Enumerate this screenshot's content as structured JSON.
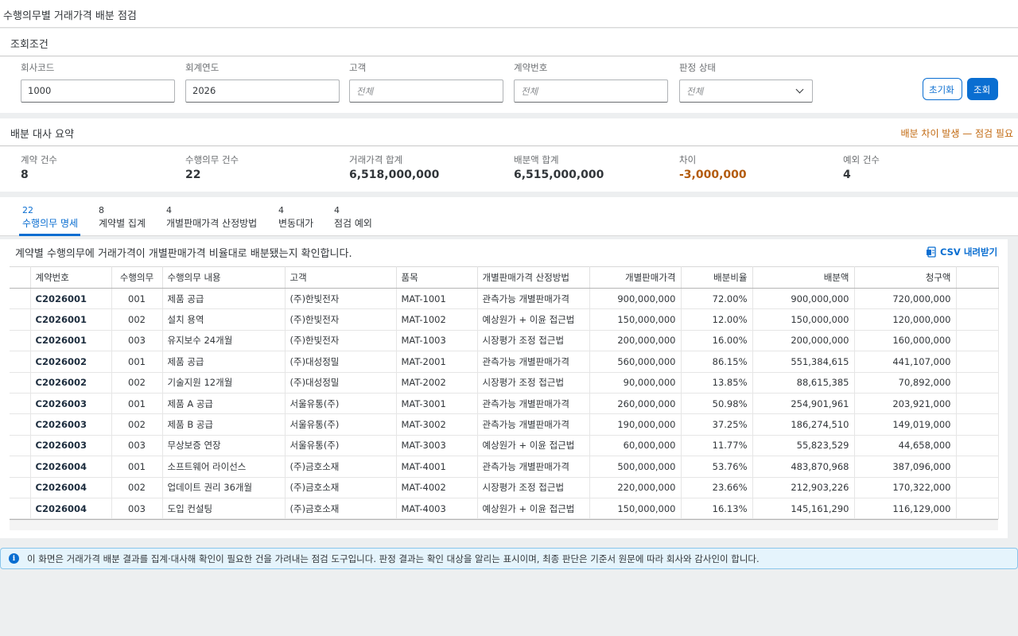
{
  "page": {
    "title": "수행의무별 거래가격 배분 점검"
  },
  "filters": {
    "section_title": "조회조건",
    "company_code": {
      "label": "회사코드",
      "value": "1000"
    },
    "fiscal_year": {
      "label": "회계연도",
      "value": "2026"
    },
    "customer": {
      "label": "고객",
      "placeholder": "전체"
    },
    "contract_no": {
      "label": "계약번호",
      "placeholder": "전체"
    },
    "status": {
      "label": "판정 상태",
      "value": "전체"
    },
    "reset_label": "초기화",
    "search_label": "조회"
  },
  "summary": {
    "section_title": "배분 대사 요약",
    "warning": "배분 차이 발생 — 점검 필요",
    "kpis": [
      {
        "label": "계약 건수",
        "value": "8"
      },
      {
        "label": "수행의무 건수",
        "value": "22"
      },
      {
        "label": "거래가격 합계",
        "value": "6,518,000,000"
      },
      {
        "label": "배분액 합계",
        "value": "6,515,000,000"
      },
      {
        "label": "차이",
        "value": "-3,000,000"
      },
      {
        "label": "예외 건수",
        "value": "4"
      }
    ]
  },
  "tabs": [
    {
      "count": "22",
      "label": "수행의무 명세"
    },
    {
      "count": "8",
      "label": "계약별 집계"
    },
    {
      "count": "4",
      "label": "개별판매가격 산정방법"
    },
    {
      "count": "4",
      "label": "변동대가"
    },
    {
      "count": "4",
      "label": "점검 예외"
    }
  ],
  "table": {
    "caption": "계약별 수행의무에 거래가격이 개별판매가격 비율대로 배분됐는지 확인합니다.",
    "csv_label": "CSV 내려받기",
    "columns": [
      "계약번호",
      "수행의무",
      "수행의무 내용",
      "고객",
      "품목",
      "개별판매가격 산정방법",
      "개별판매가격",
      "배분비율",
      "배분액",
      "청구액"
    ],
    "rows": [
      [
        "C2026001",
        "001",
        "제품 공급",
        "(주)한빛전자",
        "MAT-1001",
        "관측가능 개별판매가격",
        "900,000,000",
        "72.00%",
        "900,000,000",
        "720,000,000"
      ],
      [
        "C2026001",
        "002",
        "설치 용역",
        "(주)한빛전자",
        "MAT-1002",
        "예상원가 + 이윤 접근법",
        "150,000,000",
        "12.00%",
        "150,000,000",
        "120,000,000"
      ],
      [
        "C2026001",
        "003",
        "유지보수 24개월",
        "(주)한빛전자",
        "MAT-1003",
        "시장평가 조정 접근법",
        "200,000,000",
        "16.00%",
        "200,000,000",
        "160,000,000"
      ],
      [
        "C2026002",
        "001",
        "제품 공급",
        "(주)대성정밀",
        "MAT-2001",
        "관측가능 개별판매가격",
        "560,000,000",
        "86.15%",
        "551,384,615",
        "441,107,000"
      ],
      [
        "C2026002",
        "002",
        "기술지원 12개월",
        "(주)대성정밀",
        "MAT-2002",
        "시장평가 조정 접근법",
        "90,000,000",
        "13.85%",
        "88,615,385",
        "70,892,000"
      ],
      [
        "C2026003",
        "001",
        "제품 A 공급",
        "서울유통(주)",
        "MAT-3001",
        "관측가능 개별판매가격",
        "260,000,000",
        "50.98%",
        "254,901,961",
        "203,921,000"
      ],
      [
        "C2026003",
        "002",
        "제품 B 공급",
        "서울유통(주)",
        "MAT-3002",
        "관측가능 개별판매가격",
        "190,000,000",
        "37.25%",
        "186,274,510",
        "149,019,000"
      ],
      [
        "C2026003",
        "003",
        "무상보증 연장",
        "서울유통(주)",
        "MAT-3003",
        "예상원가 + 이윤 접근법",
        "60,000,000",
        "11.77%",
        "55,823,529",
        "44,658,000"
      ],
      [
        "C2026004",
        "001",
        "소프트웨어 라이선스",
        "(주)금호소재",
        "MAT-4001",
        "관측가능 개별판매가격",
        "500,000,000",
        "53.76%",
        "483,870,968",
        "387,096,000"
      ],
      [
        "C2026004",
        "002",
        "업데이트 권리 36개월",
        "(주)금호소재",
        "MAT-4002",
        "시장평가 조정 접근법",
        "220,000,000",
        "23.66%",
        "212,903,226",
        "170,322,000"
      ],
      [
        "C2026004",
        "003",
        "도입 컨설팅",
        "(주)금호소재",
        "MAT-4003",
        "예상원가 + 이윤 접근법",
        "150,000,000",
        "16.13%",
        "145,161,290",
        "116,129,000"
      ]
    ]
  },
  "info": {
    "text": "이 화면은 거래가격 배분 결과를 집계·대사해 확인이 필요한 건을 가려내는 점검 도구입니다. 판정 결과는 확인 대상을 알리는 표시이며, 최종 판단은 기준서 원문에 따라 회사와 감사인이 합니다."
  }
}
